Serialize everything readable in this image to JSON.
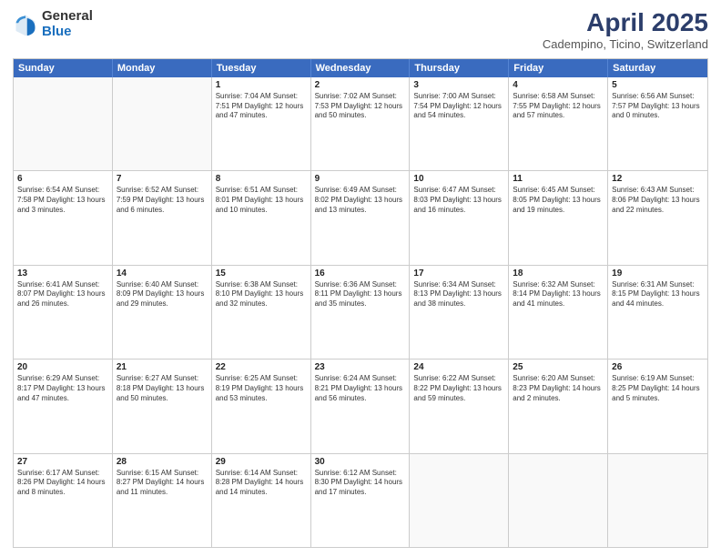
{
  "header": {
    "logo_general": "General",
    "logo_blue": "Blue",
    "month_year": "April 2025",
    "location": "Cadempino, Ticino, Switzerland"
  },
  "weekdays": [
    "Sunday",
    "Monday",
    "Tuesday",
    "Wednesday",
    "Thursday",
    "Friday",
    "Saturday"
  ],
  "rows": [
    [
      {
        "day": "",
        "text": ""
      },
      {
        "day": "",
        "text": ""
      },
      {
        "day": "1",
        "text": "Sunrise: 7:04 AM\nSunset: 7:51 PM\nDaylight: 12 hours and 47 minutes."
      },
      {
        "day": "2",
        "text": "Sunrise: 7:02 AM\nSunset: 7:53 PM\nDaylight: 12 hours and 50 minutes."
      },
      {
        "day": "3",
        "text": "Sunrise: 7:00 AM\nSunset: 7:54 PM\nDaylight: 12 hours and 54 minutes."
      },
      {
        "day": "4",
        "text": "Sunrise: 6:58 AM\nSunset: 7:55 PM\nDaylight: 12 hours and 57 minutes."
      },
      {
        "day": "5",
        "text": "Sunrise: 6:56 AM\nSunset: 7:57 PM\nDaylight: 13 hours and 0 minutes."
      }
    ],
    [
      {
        "day": "6",
        "text": "Sunrise: 6:54 AM\nSunset: 7:58 PM\nDaylight: 13 hours and 3 minutes."
      },
      {
        "day": "7",
        "text": "Sunrise: 6:52 AM\nSunset: 7:59 PM\nDaylight: 13 hours and 6 minutes."
      },
      {
        "day": "8",
        "text": "Sunrise: 6:51 AM\nSunset: 8:01 PM\nDaylight: 13 hours and 10 minutes."
      },
      {
        "day": "9",
        "text": "Sunrise: 6:49 AM\nSunset: 8:02 PM\nDaylight: 13 hours and 13 minutes."
      },
      {
        "day": "10",
        "text": "Sunrise: 6:47 AM\nSunset: 8:03 PM\nDaylight: 13 hours and 16 minutes."
      },
      {
        "day": "11",
        "text": "Sunrise: 6:45 AM\nSunset: 8:05 PM\nDaylight: 13 hours and 19 minutes."
      },
      {
        "day": "12",
        "text": "Sunrise: 6:43 AM\nSunset: 8:06 PM\nDaylight: 13 hours and 22 minutes."
      }
    ],
    [
      {
        "day": "13",
        "text": "Sunrise: 6:41 AM\nSunset: 8:07 PM\nDaylight: 13 hours and 26 minutes."
      },
      {
        "day": "14",
        "text": "Sunrise: 6:40 AM\nSunset: 8:09 PM\nDaylight: 13 hours and 29 minutes."
      },
      {
        "day": "15",
        "text": "Sunrise: 6:38 AM\nSunset: 8:10 PM\nDaylight: 13 hours and 32 minutes."
      },
      {
        "day": "16",
        "text": "Sunrise: 6:36 AM\nSunset: 8:11 PM\nDaylight: 13 hours and 35 minutes."
      },
      {
        "day": "17",
        "text": "Sunrise: 6:34 AM\nSunset: 8:13 PM\nDaylight: 13 hours and 38 minutes."
      },
      {
        "day": "18",
        "text": "Sunrise: 6:32 AM\nSunset: 8:14 PM\nDaylight: 13 hours and 41 minutes."
      },
      {
        "day": "19",
        "text": "Sunrise: 6:31 AM\nSunset: 8:15 PM\nDaylight: 13 hours and 44 minutes."
      }
    ],
    [
      {
        "day": "20",
        "text": "Sunrise: 6:29 AM\nSunset: 8:17 PM\nDaylight: 13 hours and 47 minutes."
      },
      {
        "day": "21",
        "text": "Sunrise: 6:27 AM\nSunset: 8:18 PM\nDaylight: 13 hours and 50 minutes."
      },
      {
        "day": "22",
        "text": "Sunrise: 6:25 AM\nSunset: 8:19 PM\nDaylight: 13 hours and 53 minutes."
      },
      {
        "day": "23",
        "text": "Sunrise: 6:24 AM\nSunset: 8:21 PM\nDaylight: 13 hours and 56 minutes."
      },
      {
        "day": "24",
        "text": "Sunrise: 6:22 AM\nSunset: 8:22 PM\nDaylight: 13 hours and 59 minutes."
      },
      {
        "day": "25",
        "text": "Sunrise: 6:20 AM\nSunset: 8:23 PM\nDaylight: 14 hours and 2 minutes."
      },
      {
        "day": "26",
        "text": "Sunrise: 6:19 AM\nSunset: 8:25 PM\nDaylight: 14 hours and 5 minutes."
      }
    ],
    [
      {
        "day": "27",
        "text": "Sunrise: 6:17 AM\nSunset: 8:26 PM\nDaylight: 14 hours and 8 minutes."
      },
      {
        "day": "28",
        "text": "Sunrise: 6:15 AM\nSunset: 8:27 PM\nDaylight: 14 hours and 11 minutes."
      },
      {
        "day": "29",
        "text": "Sunrise: 6:14 AM\nSunset: 8:28 PM\nDaylight: 14 hours and 14 minutes."
      },
      {
        "day": "30",
        "text": "Sunrise: 6:12 AM\nSunset: 8:30 PM\nDaylight: 14 hours and 17 minutes."
      },
      {
        "day": "",
        "text": ""
      },
      {
        "day": "",
        "text": ""
      },
      {
        "day": "",
        "text": ""
      }
    ]
  ]
}
